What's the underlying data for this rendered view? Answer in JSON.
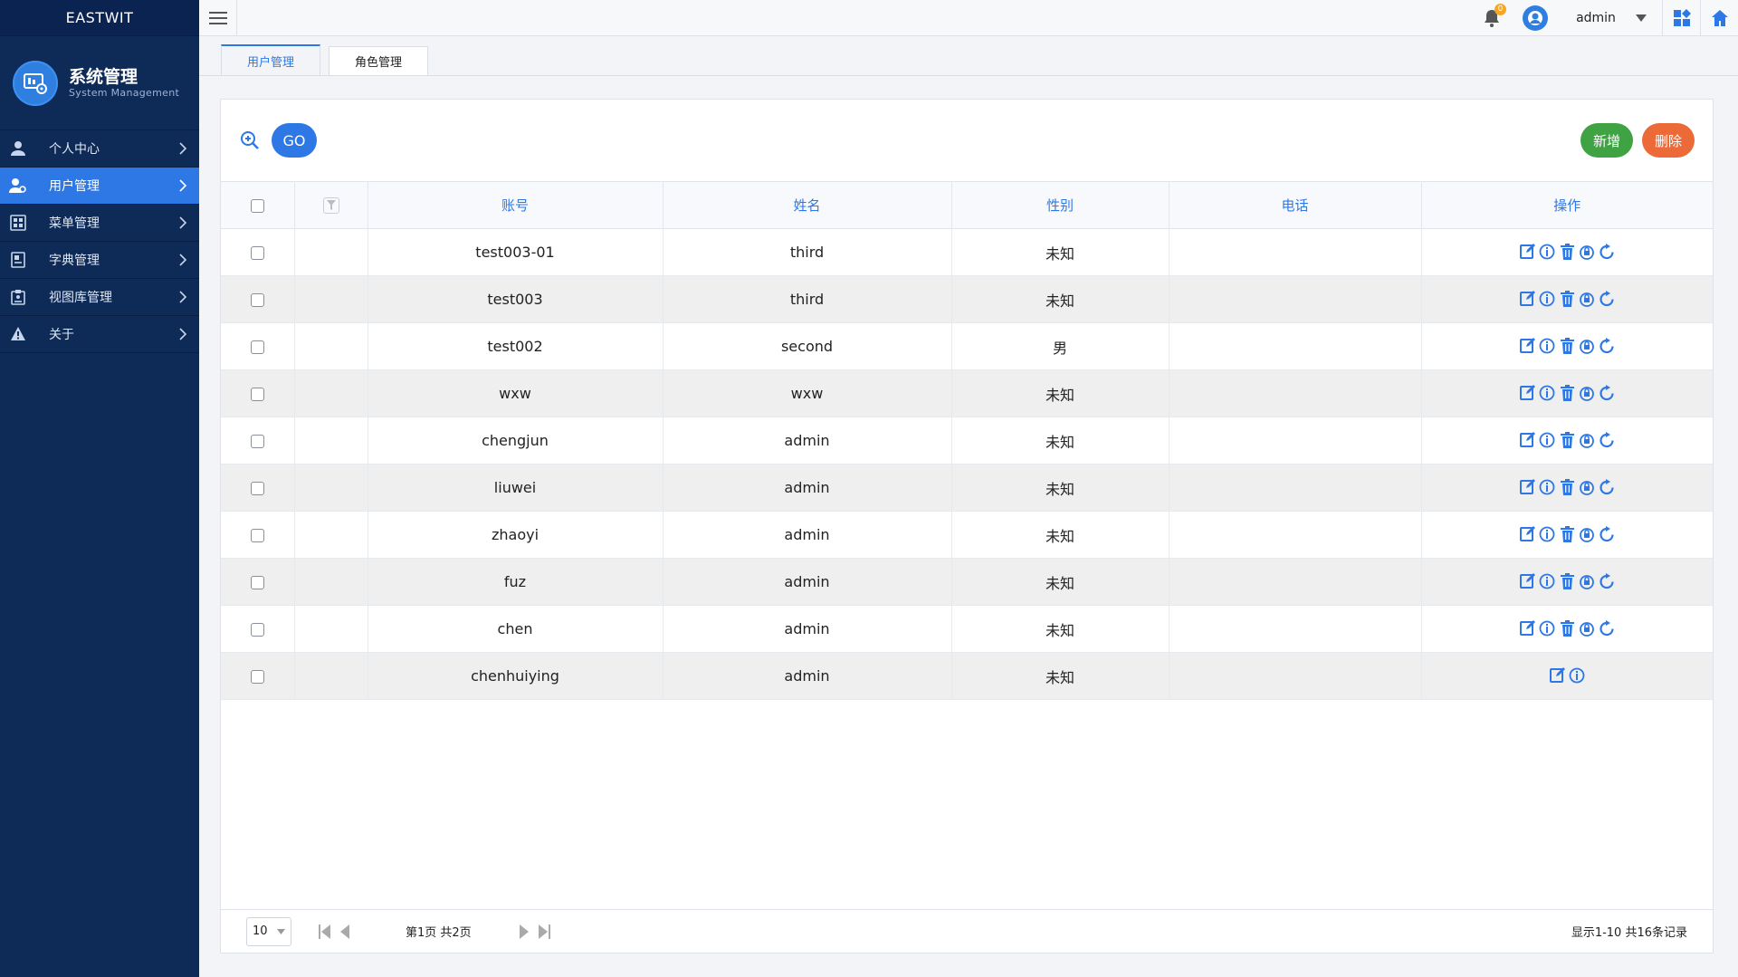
{
  "app": {
    "brand": "EASTWIT"
  },
  "module": {
    "title": "系统管理",
    "subtitle": "System  Management"
  },
  "sidebar": {
    "items": [
      {
        "label": "个人中心",
        "icon": "user-icon",
        "active": false
      },
      {
        "label": "用户管理",
        "icon": "users-icon",
        "active": true
      },
      {
        "label": "菜单管理",
        "icon": "menu-grid-icon",
        "active": false
      },
      {
        "label": "字典管理",
        "icon": "dictionary-icon",
        "active": false
      },
      {
        "label": "视图库管理",
        "icon": "view-library-icon",
        "active": false
      },
      {
        "label": "关于",
        "icon": "warning-icon",
        "active": false
      }
    ]
  },
  "header": {
    "notification_count": "0",
    "username": "admin"
  },
  "tabs": [
    {
      "label": "用户管理",
      "active": true
    },
    {
      "label": "角色管理",
      "active": false
    }
  ],
  "toolbar": {
    "go_label": "GO",
    "add_label": "新增",
    "delete_label": "删除"
  },
  "table": {
    "columns": [
      "账号",
      "姓名",
      "性别",
      "电话",
      "操作"
    ],
    "rows": [
      {
        "account": "test003-01",
        "name": "third",
        "gender": "未知",
        "phone": "",
        "ops": [
          "edit",
          "info",
          "delete",
          "reset-password",
          "refresh"
        ]
      },
      {
        "account": "test003",
        "name": "third",
        "gender": "未知",
        "phone": "",
        "ops": [
          "edit",
          "info",
          "delete",
          "reset-password",
          "refresh"
        ]
      },
      {
        "account": "test002",
        "name": "second",
        "gender": "男",
        "phone": "",
        "ops": [
          "edit",
          "info",
          "delete",
          "reset-password",
          "refresh"
        ]
      },
      {
        "account": "wxw",
        "name": "wxw",
        "gender": "未知",
        "phone": "",
        "ops": [
          "edit",
          "info",
          "delete",
          "reset-password",
          "refresh"
        ]
      },
      {
        "account": "chengjun",
        "name": "admin",
        "gender": "未知",
        "phone": "",
        "ops": [
          "edit",
          "info",
          "delete",
          "reset-password",
          "refresh"
        ]
      },
      {
        "account": "liuwei",
        "name": "admin",
        "gender": "未知",
        "phone": "",
        "ops": [
          "edit",
          "info",
          "delete",
          "reset-password",
          "refresh"
        ]
      },
      {
        "account": "zhaoyi",
        "name": "admin",
        "gender": "未知",
        "phone": "",
        "ops": [
          "edit",
          "info",
          "delete",
          "reset-password",
          "refresh"
        ]
      },
      {
        "account": "fuz",
        "name": "admin",
        "gender": "未知",
        "phone": "",
        "ops": [
          "edit",
          "info",
          "delete",
          "reset-password",
          "refresh"
        ]
      },
      {
        "account": "chen",
        "name": "admin",
        "gender": "未知",
        "phone": "",
        "ops": [
          "edit",
          "info",
          "delete",
          "reset-password",
          "refresh"
        ]
      },
      {
        "account": "chenhuiying",
        "name": "admin",
        "gender": "未知",
        "phone": "",
        "ops": [
          "edit",
          "info"
        ]
      }
    ]
  },
  "pager": {
    "page_size": "10",
    "page_info": "第1页 共2页",
    "summary": "显示1-10 共16条记录"
  },
  "colors": {
    "sidebar_bg": "#0e2a57",
    "accent": "#2e78e6",
    "add_button": "#3fa243",
    "delete_button": "#ec6a38"
  }
}
